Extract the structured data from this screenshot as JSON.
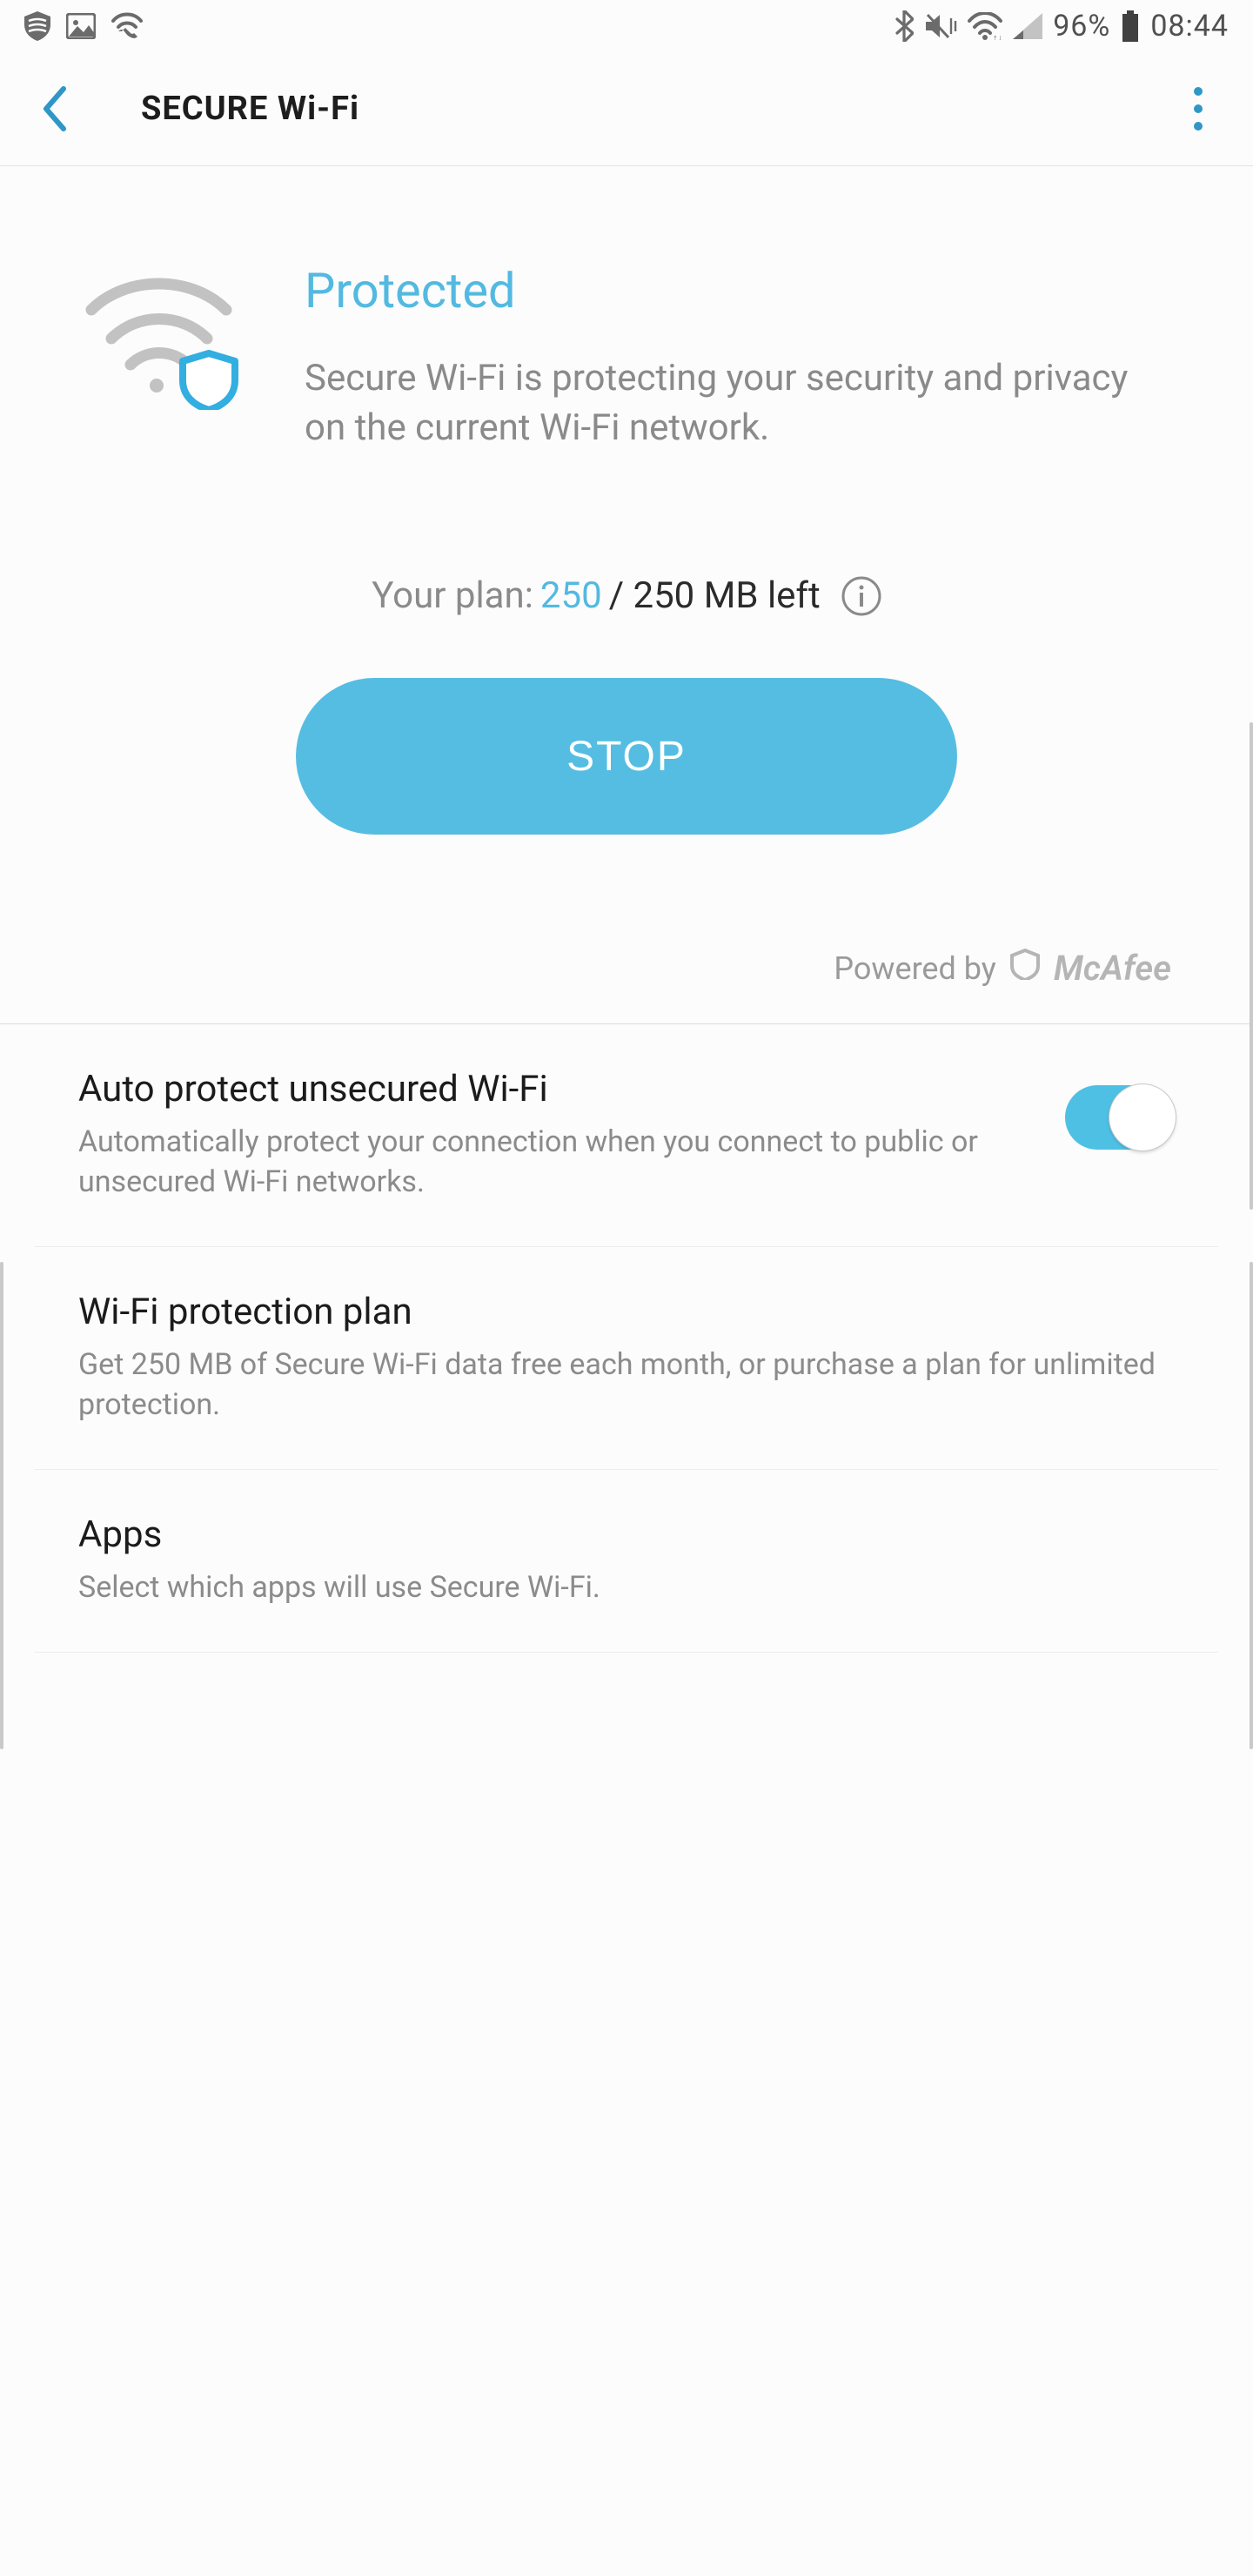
{
  "status": {
    "battery_percent": "96%",
    "time": "08:44"
  },
  "appbar": {
    "title": "SECURE Wi-Fi"
  },
  "hero": {
    "title": "Protected",
    "description": "Secure Wi-Fi is protecting your security and privacy on the current Wi-Fi network.",
    "plan_label": "Your plan:",
    "plan_used": "250",
    "plan_total": "/ 250 MB left",
    "stop_label": "STOP",
    "powered_by": "Powered by",
    "powered_brand": "McAfee"
  },
  "settings": [
    {
      "title": "Auto protect unsecured Wi-Fi",
      "desc": "Automatically protect your connection when you connect to public or unsecured Wi-Fi networks.",
      "toggle": true
    },
    {
      "title": "Wi-Fi protection plan",
      "desc": "Get 250 MB of Secure Wi-Fi data free each month, or purchase a plan for unlimited protection."
    },
    {
      "title": "Apps",
      "desc": "Select which apps will use Secure Wi-Fi."
    }
  ]
}
